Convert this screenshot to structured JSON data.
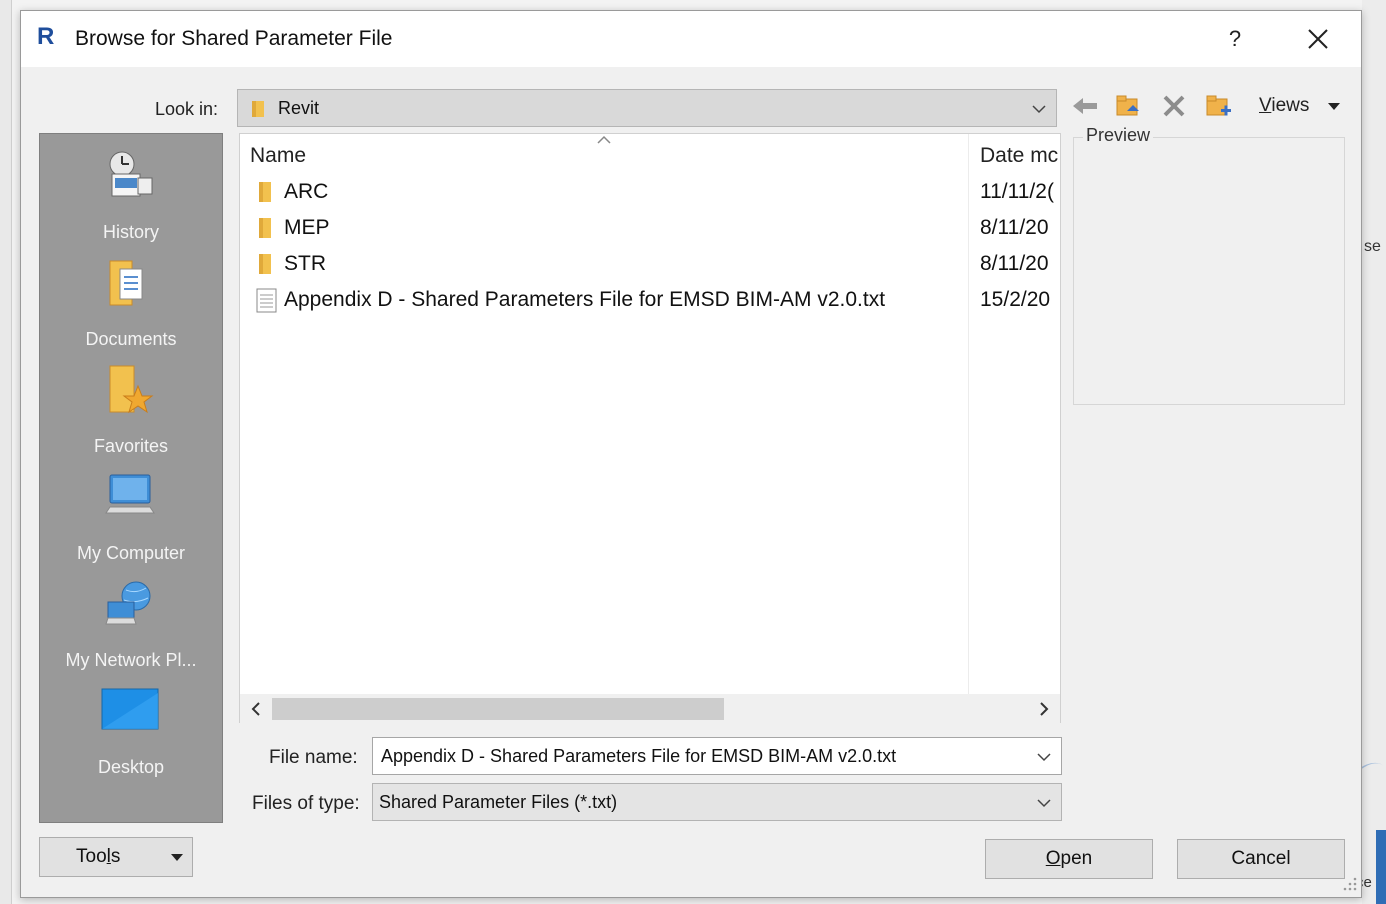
{
  "window": {
    "title": "Browse for Shared Parameter File",
    "app_icon_letter": "R",
    "help_label": "?"
  },
  "look_in": {
    "label": "Look in:",
    "value": "Revit"
  },
  "toolbar": {
    "views_label_prefix": "V",
    "views_label_rest": "iews"
  },
  "places": [
    {
      "label": "History",
      "icon": "history-icon"
    },
    {
      "label": "Documents",
      "icon": "documents-icon"
    },
    {
      "label": "Favorites",
      "icon": "favorites-icon"
    },
    {
      "label": "My Computer",
      "icon": "my-computer-icon"
    },
    {
      "label": "My Network Pl...",
      "icon": "network-places-icon"
    },
    {
      "label": "Desktop",
      "icon": "desktop-icon"
    }
  ],
  "file_list": {
    "columns": {
      "name": "Name",
      "date": "Date mc"
    },
    "rows": [
      {
        "name": "ARC",
        "date": "11/11/2(",
        "type": "folder"
      },
      {
        "name": "MEP",
        "date": "8/11/20",
        "type": "folder"
      },
      {
        "name": "STR",
        "date": "8/11/20",
        "type": "folder"
      },
      {
        "name": "Appendix D - Shared Parameters File for EMSD BIM-AM v2.0.txt",
        "date": "15/2/20",
        "type": "text-file"
      }
    ]
  },
  "preview": {
    "label": "Preview"
  },
  "file_name": {
    "label": "File name:",
    "value": "Appendix D - Shared Parameters File for EMSD BIM-AM v2.0.txt"
  },
  "file_type": {
    "label": "Files of type:",
    "value": "Shared Parameter Files (*.txt)"
  },
  "buttons": {
    "tools_prefix": "Too",
    "tools_underline": "l",
    "tools_suffix": "s",
    "open_underline": "O",
    "open_rest": "pen",
    "cancel": "Cancel"
  },
  "background": {
    "right_edge_text": "se",
    "bottom_right_text": "ce"
  },
  "colors": {
    "places_bg": "#999999",
    "dialog_bg": "#f0f0f0",
    "folder_yellow": "#f2c14e",
    "revit_blue": "#1f4e9c"
  }
}
